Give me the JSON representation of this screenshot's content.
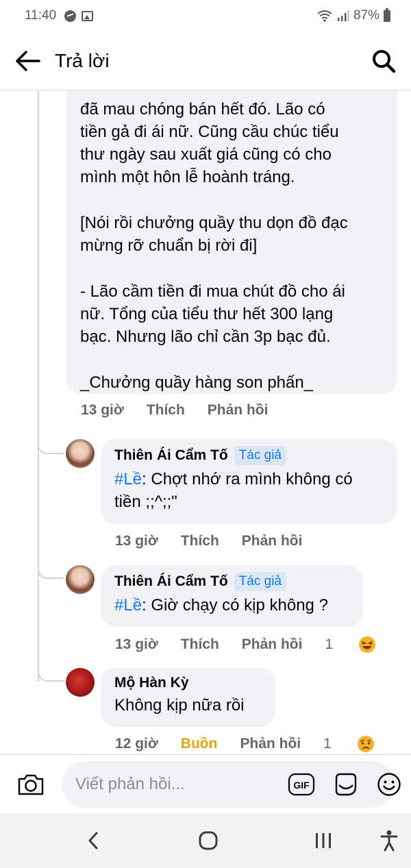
{
  "status_bar": {
    "time": "11:40",
    "battery": "87%"
  },
  "header": {
    "title": "Trả lời"
  },
  "main_comment": {
    "paragraphs": [
      "đã mau chóng bán hết đó. Lão có\ntiền gả đi ái nữ. Cũng cầu chúc tiểu\nthư ngày sau xuất giá cũng có cho\nmình một hôn lễ hoành tráng.",
      "[Nói rồi chưởng quầy thu dọn đồ đạc\nmừng rỡ chuẩn bị rời đi]",
      "- Lão cầm tiền đi mua chút đồ cho ái\nnữ. Tổng của tiểu thư hết 300 lạng\nbạc. Nhưng lão chỉ cần 3p bạc đủ.",
      "_Chưởng quầy hàng son phấn_"
    ],
    "time": "13 giờ",
    "like_label": "Thích",
    "reply_label": "Phản hồi"
  },
  "replies": [
    {
      "author": "Thiên Ái Cẩm Tố",
      "badge": "Tác giả",
      "mention": "#Lề",
      "text": ": Chợt nhớ ra mình không có\ntiền ;;^;;\"",
      "time": "13 giờ",
      "like_label": "Thích",
      "reply_label": "Phản hồi"
    },
    {
      "author": "Thiên Ái Cẩm Tố",
      "badge": "Tác giả",
      "mention": "#Lề",
      "text": ": Giờ chạy có kịp không ?",
      "time": "13 giờ",
      "like_label": "Thích",
      "reply_label": "Phản hồi",
      "reaction_count": "1",
      "reaction_icon": "laughing-emoji-icon"
    },
    {
      "author": "Mộ Hàn Kỳ",
      "text": "Không kịp nữa rồi",
      "time": "12 giờ",
      "like_label": "Buồn",
      "reply_label": "Phản hồi",
      "reaction_count": "1",
      "reaction_icon": "sad-emoji-icon"
    }
  ],
  "composer": {
    "placeholder": "Viết phản hồi...",
    "gif_label": "GIF"
  },
  "colors": {
    "accent": "#1877f2",
    "sad_reaction": "#e6a40e",
    "bubble": "#f0f2f5",
    "meta": "#65676b"
  }
}
